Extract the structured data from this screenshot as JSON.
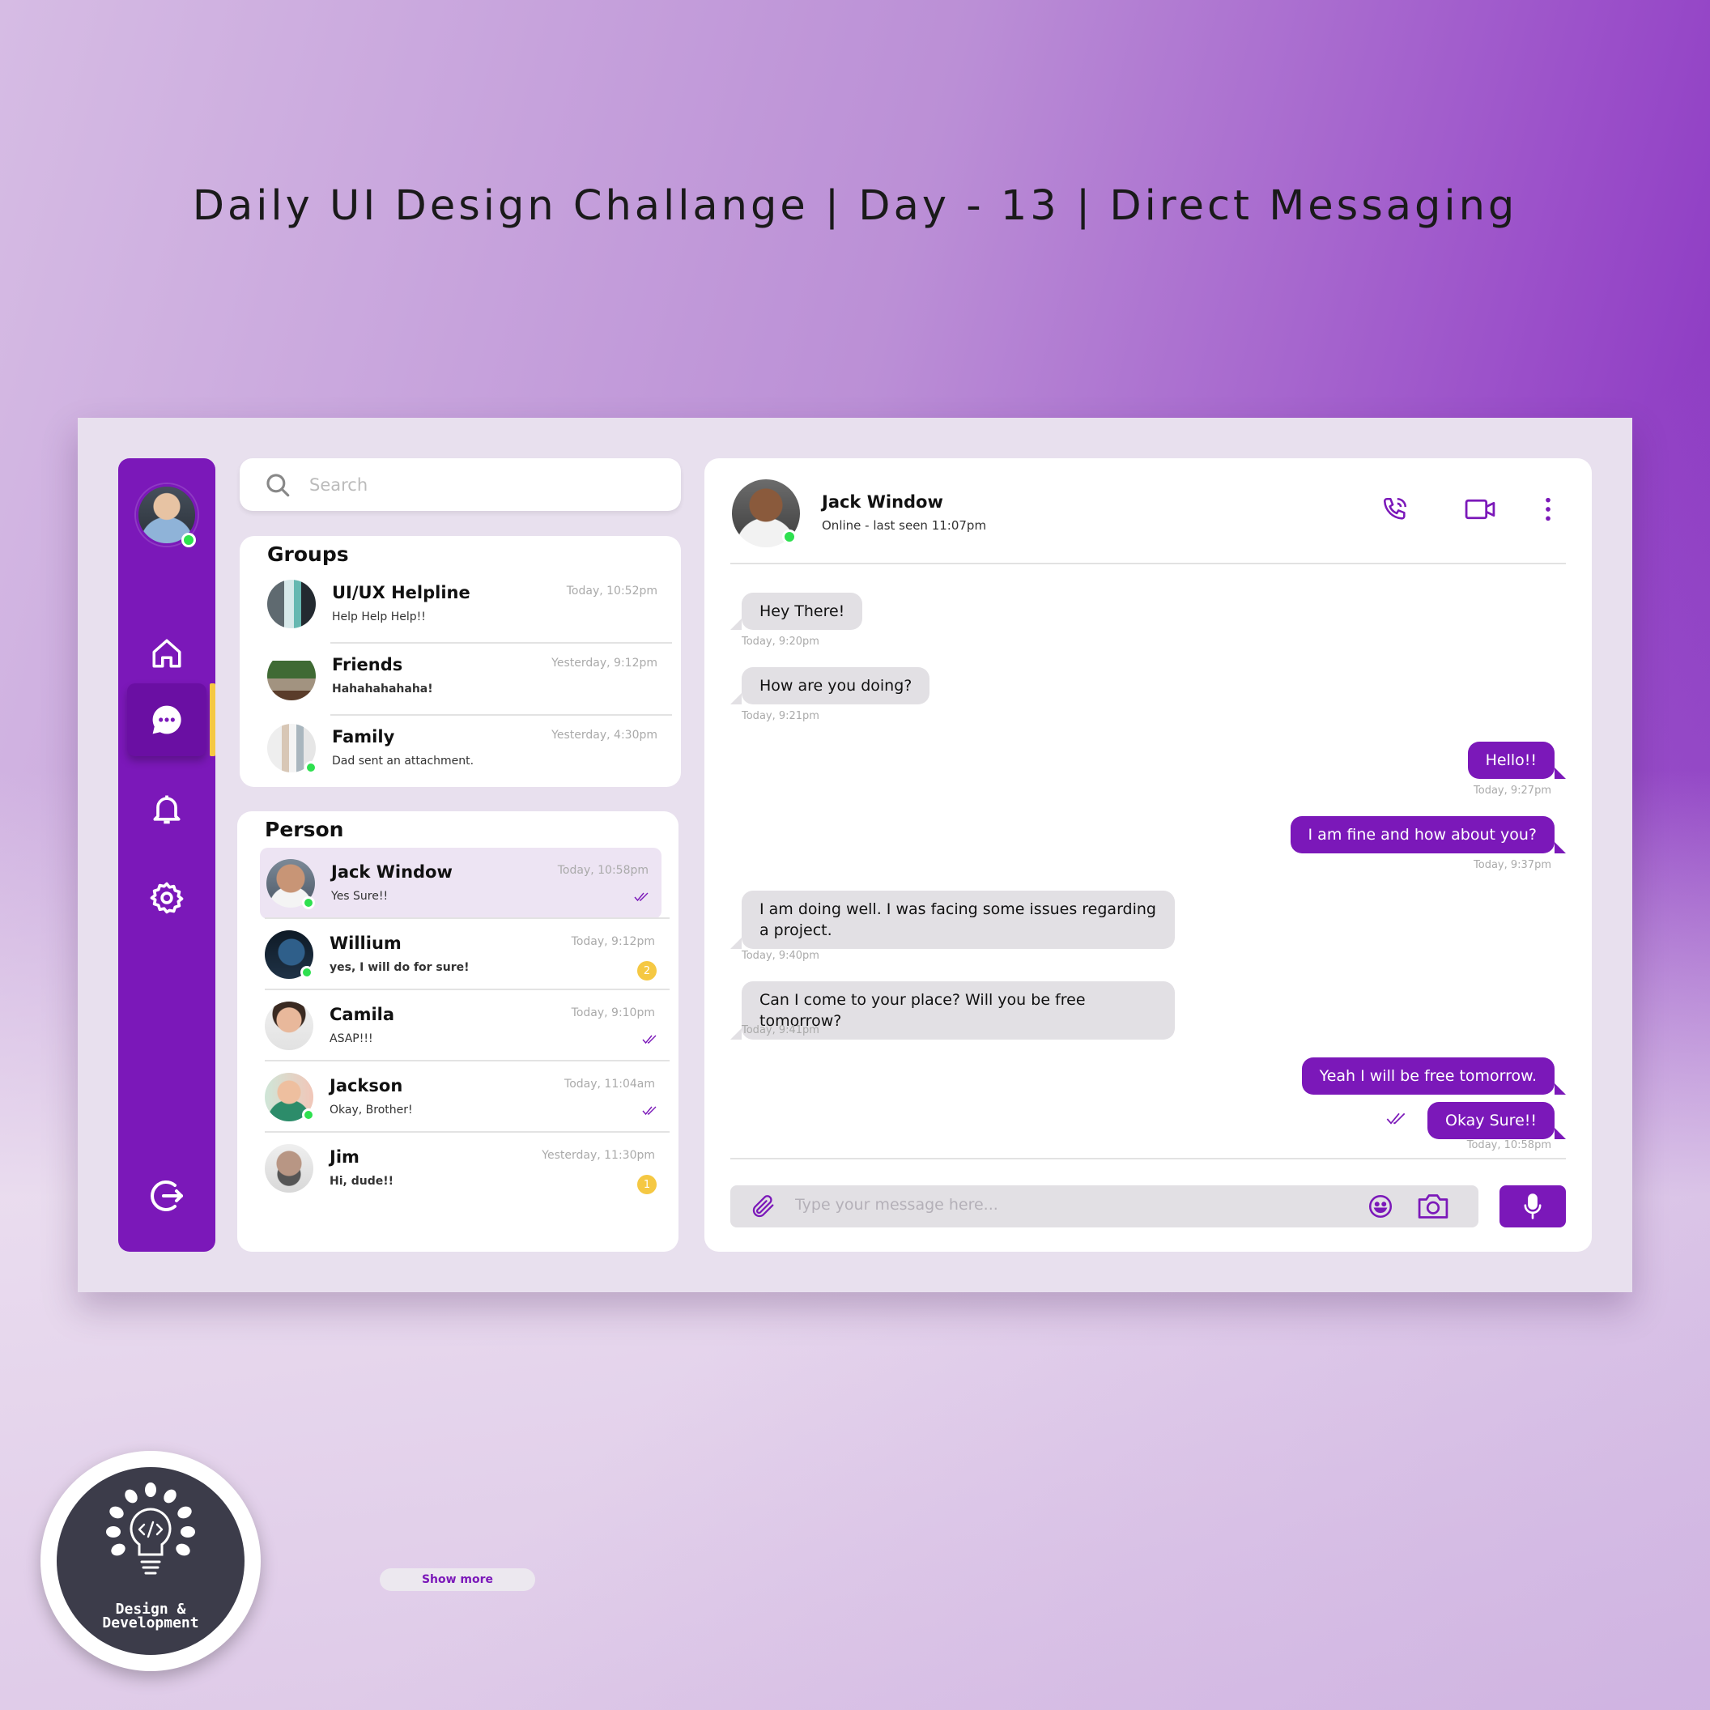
{
  "header": {
    "title": "Daily UI Design Challange | Day - 13 | Direct Messaging"
  },
  "colors": {
    "accent": "#7b18b9",
    "online": "#2ee04f",
    "badge": "#f5c843",
    "indicator": "#f5c843"
  },
  "sidebar": {
    "items": [
      {
        "name": "home",
        "icon": "home-icon"
      },
      {
        "name": "messages",
        "icon": "chat-icon",
        "active": true
      },
      {
        "name": "notifications",
        "icon": "bell-icon"
      },
      {
        "name": "settings",
        "icon": "gear-icon"
      }
    ],
    "logout_icon": "logout-icon"
  },
  "search": {
    "placeholder": "Search"
  },
  "groups": {
    "title": "Groups",
    "items": [
      {
        "name": "UI/UX Helpline",
        "message": "Help Help Help!!",
        "time": "Today, 10:52pm"
      },
      {
        "name": "Friends",
        "message": "Hahahahahaha!",
        "time": "Yesterday, 9:12pm"
      },
      {
        "name": "Family",
        "message": "Dad sent an attachment.",
        "time": "Yesterday, 4:30pm"
      }
    ]
  },
  "persons": {
    "title": "Person",
    "items": [
      {
        "name": "Jack Window",
        "message": "Yes Sure!!",
        "time": "Today, 10:58pm",
        "status": "read"
      },
      {
        "name": "Willium",
        "message": "yes, I will do for sure!",
        "time": "Today, 9:12pm",
        "unread": "2"
      },
      {
        "name": "Camila",
        "message": "ASAP!!!",
        "time": "Today, 9:10pm",
        "status": "read"
      },
      {
        "name": "Jackson",
        "message": "Okay, Brother!",
        "time": "Today, 11:04am",
        "status": "read"
      },
      {
        "name": "Jim",
        "message": "Hi, dude!!",
        "time": "Yesterday, 11:30pm",
        "unread": "1"
      }
    ],
    "show_more": "Show more"
  },
  "chat": {
    "contact_name": "Jack Window",
    "contact_status": "Online - last seen 11:07pm",
    "header_icons": [
      "phone-icon",
      "video-icon",
      "more-vertical-icon"
    ],
    "messages": [
      {
        "direction": "in",
        "text": "Hey There!",
        "time": "Today, 9:20pm"
      },
      {
        "direction": "in",
        "text": "How are you doing?",
        "time": "Today, 9:21pm"
      },
      {
        "direction": "out",
        "text": "Hello!!",
        "time": "Today, 9:27pm"
      },
      {
        "direction": "out",
        "text": "I am fine and how about you?",
        "time": "Today, 9:37pm"
      },
      {
        "direction": "in",
        "text": "I am doing well. I was facing some issues regarding a project.",
        "time": "Today, 9:40pm"
      },
      {
        "direction": "in",
        "text": "Can I come to your place? Will you be free tomorrow?",
        "time": "Today, 9:41pm"
      },
      {
        "direction": "out",
        "text": "Yeah I will be free tomorrow.",
        "time": ""
      },
      {
        "direction": "out",
        "text": "Okay Sure!!",
        "time": "Today, 10:58pm"
      }
    ],
    "composer_placeholder": "Type your message here...",
    "composer_icons": [
      "attachment-icon",
      "emoji-icon",
      "camera-icon",
      "microphone-icon"
    ]
  },
  "logo": {
    "line1": "Design &",
    "line2": "Development"
  }
}
